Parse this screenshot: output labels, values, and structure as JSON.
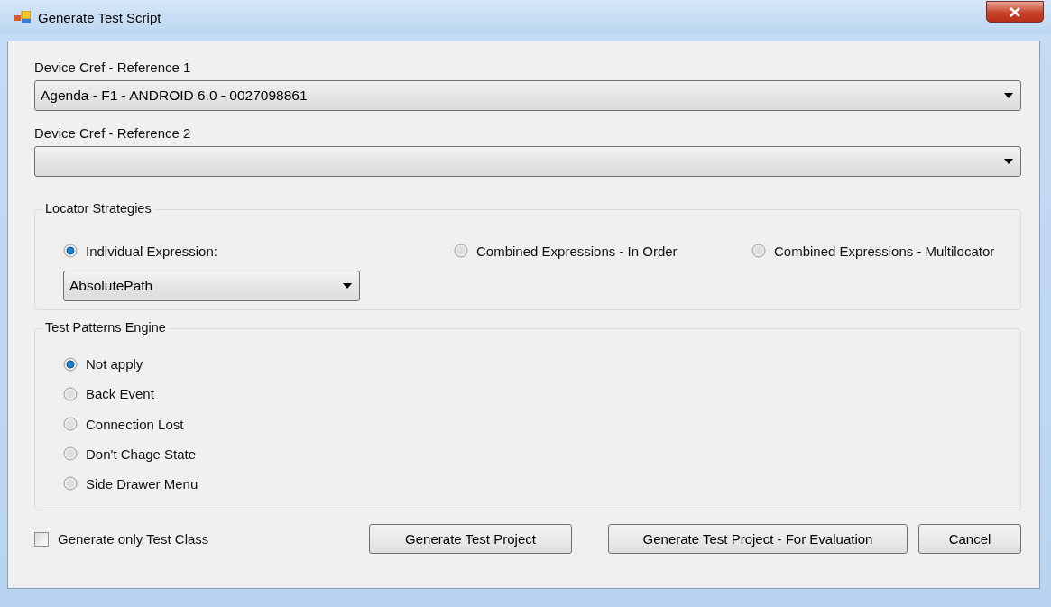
{
  "window": {
    "title": "Generate Test Script"
  },
  "devices": [
    {
      "label": "Device Cref - Reference 1",
      "value": "Agenda - F1 - ANDROID 6.0 - 0027098861"
    },
    {
      "label": "Device Cref - Reference 2"
    }
  ],
  "locator_strategies": {
    "title": "Locator Strategies",
    "expression": "AbsolutePath",
    "options": [
      {
        "label": "Individual Expression:",
        "selected": true
      },
      {
        "label": "Combined Expressions - In Order",
        "selected": false
      },
      {
        "label": "Combined Expressions - Multilocator",
        "selected": false
      }
    ]
  },
  "test_patterns": {
    "title": "Test Patterns Engine",
    "options": [
      {
        "label": "Not apply",
        "selected": true
      },
      {
        "label": "Back Event",
        "selected": false
      },
      {
        "label": "Connection Lost",
        "selected": false
      },
      {
        "label": "Don't Chage State",
        "selected": false
      },
      {
        "label": "Side Drawer Menu",
        "selected": false
      }
    ]
  },
  "generate_only_test_class": {
    "label": "Generate only Test Class",
    "checked": false
  },
  "buttons": [
    "Generate Test Project",
    "Generate Test Project - For Evaluation",
    "Cancel"
  ]
}
